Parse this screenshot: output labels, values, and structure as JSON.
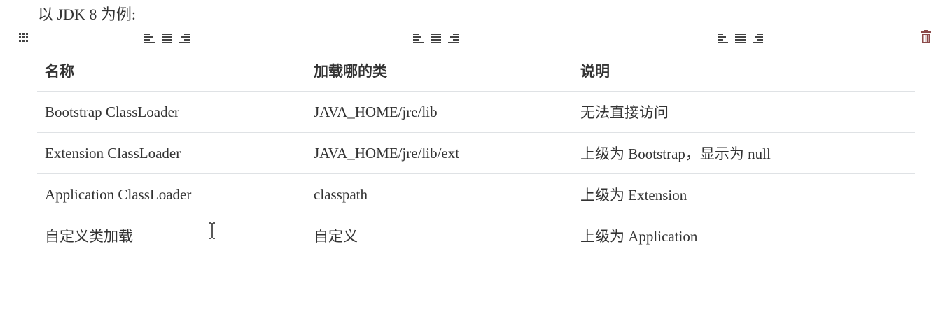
{
  "intro_text": "以 JDK 8 为例:",
  "table": {
    "headers": [
      "名称",
      "加载哪的类",
      "说明"
    ],
    "rows": [
      [
        "Bootstrap ClassLoader",
        "JAVA_HOME/jre/lib",
        "无法直接访问"
      ],
      [
        "Extension ClassLoader",
        "JAVA_HOME/jre/lib/ext",
        "上级为 Bootstrap，显示为 null"
      ],
      [
        "Application ClassLoader",
        "classpath",
        "上级为 Extension"
      ],
      [
        "自定义类加载",
        "自定义",
        "上级为 Application"
      ]
    ]
  },
  "toolbar": {
    "handle_icon": "grid-drag-icon",
    "align_icons": [
      "align-left-icon",
      "align-center-icon",
      "align-right-icon"
    ],
    "delete_icon": "trash-icon"
  },
  "colors": {
    "text": "#333333",
    "border": "#dfe2e5",
    "icon": "#444444",
    "delete": "#8b4a4a"
  }
}
